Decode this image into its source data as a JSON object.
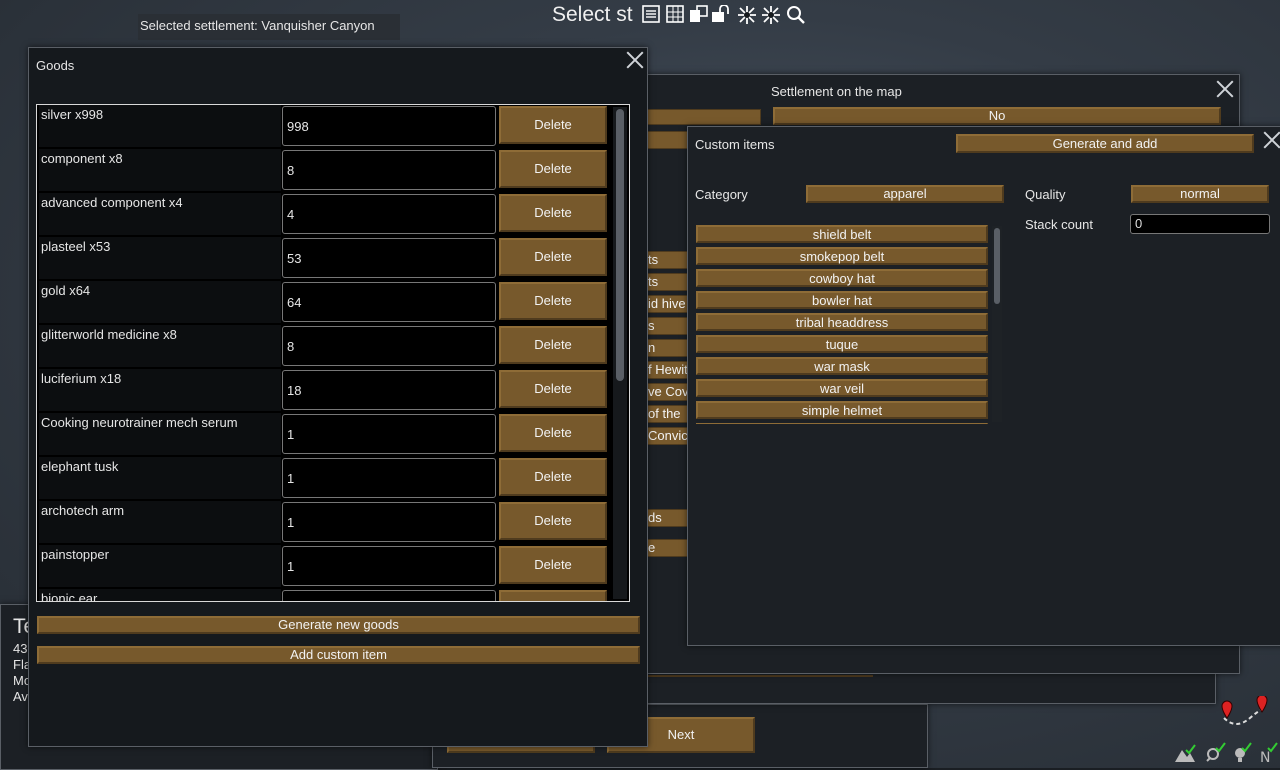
{
  "top": {
    "selected_settlement": "Selected settlement: Vanquisher Canyon",
    "select_title": "Select st"
  },
  "toolbar": {
    "icons": [
      "list-icon",
      "table-icon",
      "layers-icon",
      "lock-icon",
      "sparkle-icon",
      "sparkle-icon",
      "search-icon"
    ]
  },
  "goods": {
    "title": "Goods",
    "delete_label": "Delete",
    "items": [
      {
        "name": "silver x998",
        "qty": "998"
      },
      {
        "name": "component x8",
        "qty": "8"
      },
      {
        "name": "advanced component x4",
        "qty": "4"
      },
      {
        "name": "plasteel x53",
        "qty": "53"
      },
      {
        "name": "gold x64",
        "qty": "64"
      },
      {
        "name": "glitterworld medicine x8",
        "qty": "8"
      },
      {
        "name": "luciferium x18",
        "qty": "18"
      },
      {
        "name": "Cooking neurotrainer mech serum",
        "qty": "1"
      },
      {
        "name": "elephant tusk",
        "qty": "1"
      },
      {
        "name": "archotech arm",
        "qty": "1"
      },
      {
        "name": "painstopper",
        "qty": "1"
      },
      {
        "name": "bionic ear",
        "qty": ""
      }
    ],
    "generate_label": "Generate new goods",
    "add_custom_label": "Add custom item"
  },
  "settlement_window": {
    "title": "Settlement on the map",
    "value": "No",
    "peek_labels": [
      "ts",
      "ts",
      "id hive",
      "s",
      "n",
      "f Hewit",
      "ve Cov",
      "of the",
      "Convict",
      "ds",
      "e"
    ]
  },
  "custom_items": {
    "title": "Custom items",
    "generate_add_label": "Generate and add",
    "category_label": "Category",
    "category_value": "apparel",
    "quality_label": "Quality",
    "quality_value": "normal",
    "stack_label": "Stack count",
    "stack_value": "0",
    "items": [
      "shield belt",
      "smokepop belt",
      "cowboy hat",
      "bowler hat",
      "tribal headdress",
      "tuque",
      "war mask",
      "war veil",
      "simple helmet"
    ]
  },
  "bottom": {
    "next_label": "Next",
    "left_panel_lines": [
      "Te",
      "43",
      "Fla",
      "Mo",
      "Av"
    ]
  }
}
